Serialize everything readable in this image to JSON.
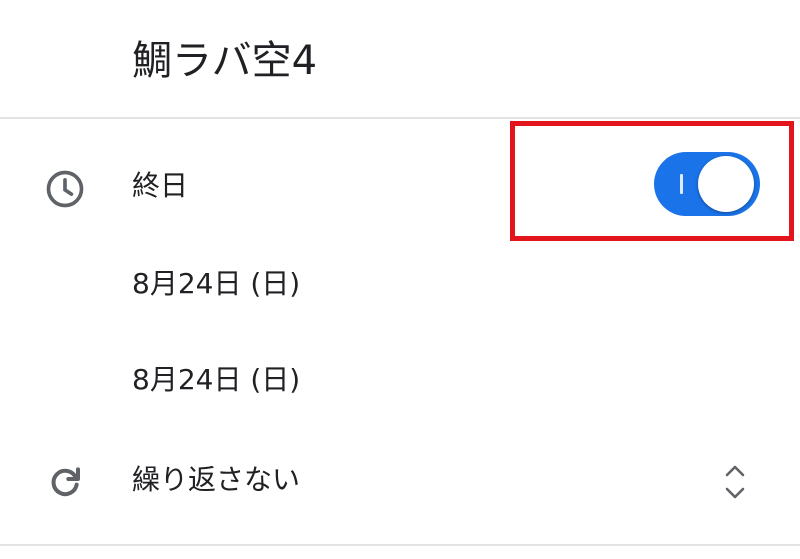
{
  "event": {
    "title": "鯛ラバ空4"
  },
  "all_day": {
    "icon": "clock-icon",
    "label": "終日",
    "toggle_on": true,
    "accent_color": "#1a73e8",
    "highlight_color": "#e2141c"
  },
  "start": {
    "date": "8月24日 (日)"
  },
  "end": {
    "date": "8月24日 (日)"
  },
  "repeat": {
    "icon": "repeat-icon",
    "label": "繰り返さない",
    "selector_icon": "unfold-icon"
  }
}
